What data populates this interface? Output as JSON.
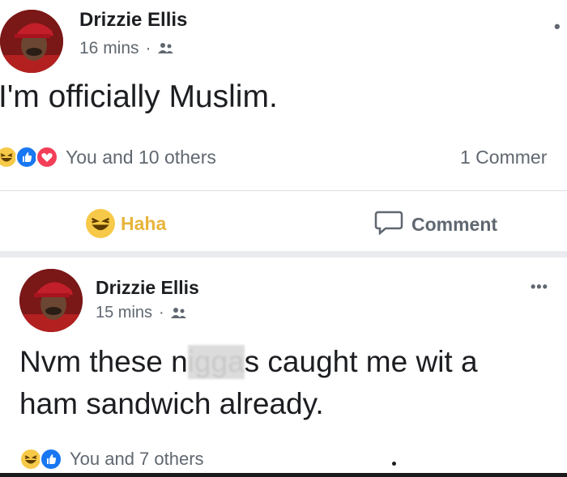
{
  "posts": [
    {
      "author": "Drizzie Ellis",
      "time": "16 mins",
      "audience_icon": "friends-icon",
      "text": "I'm officially Muslim.",
      "reactions": [
        "haha-icon",
        "like-icon",
        "love-icon"
      ],
      "reactions_text": "You and 10 others",
      "comments_count": "1 Commer",
      "actions": {
        "haha_label": "Haha",
        "comment_label": "Comment"
      },
      "colors": {
        "haha": "#e8b43a",
        "reaction_haha_bg": "#f7c948",
        "like": "#1877f2",
        "love": "#f33e58"
      }
    },
    {
      "author": "Drizzie Ellis",
      "time": "15 mins",
      "audience_icon": "friends-icon",
      "text_part1": "Nvm these n",
      "text_censored": "igga",
      "text_part2": "s caught me wit a",
      "text_line2": "ham sandwich already.",
      "reactions": [
        "haha-icon",
        "like-icon"
      ],
      "reactions_text": "You and 7 others",
      "more_label": "•••"
    }
  ]
}
